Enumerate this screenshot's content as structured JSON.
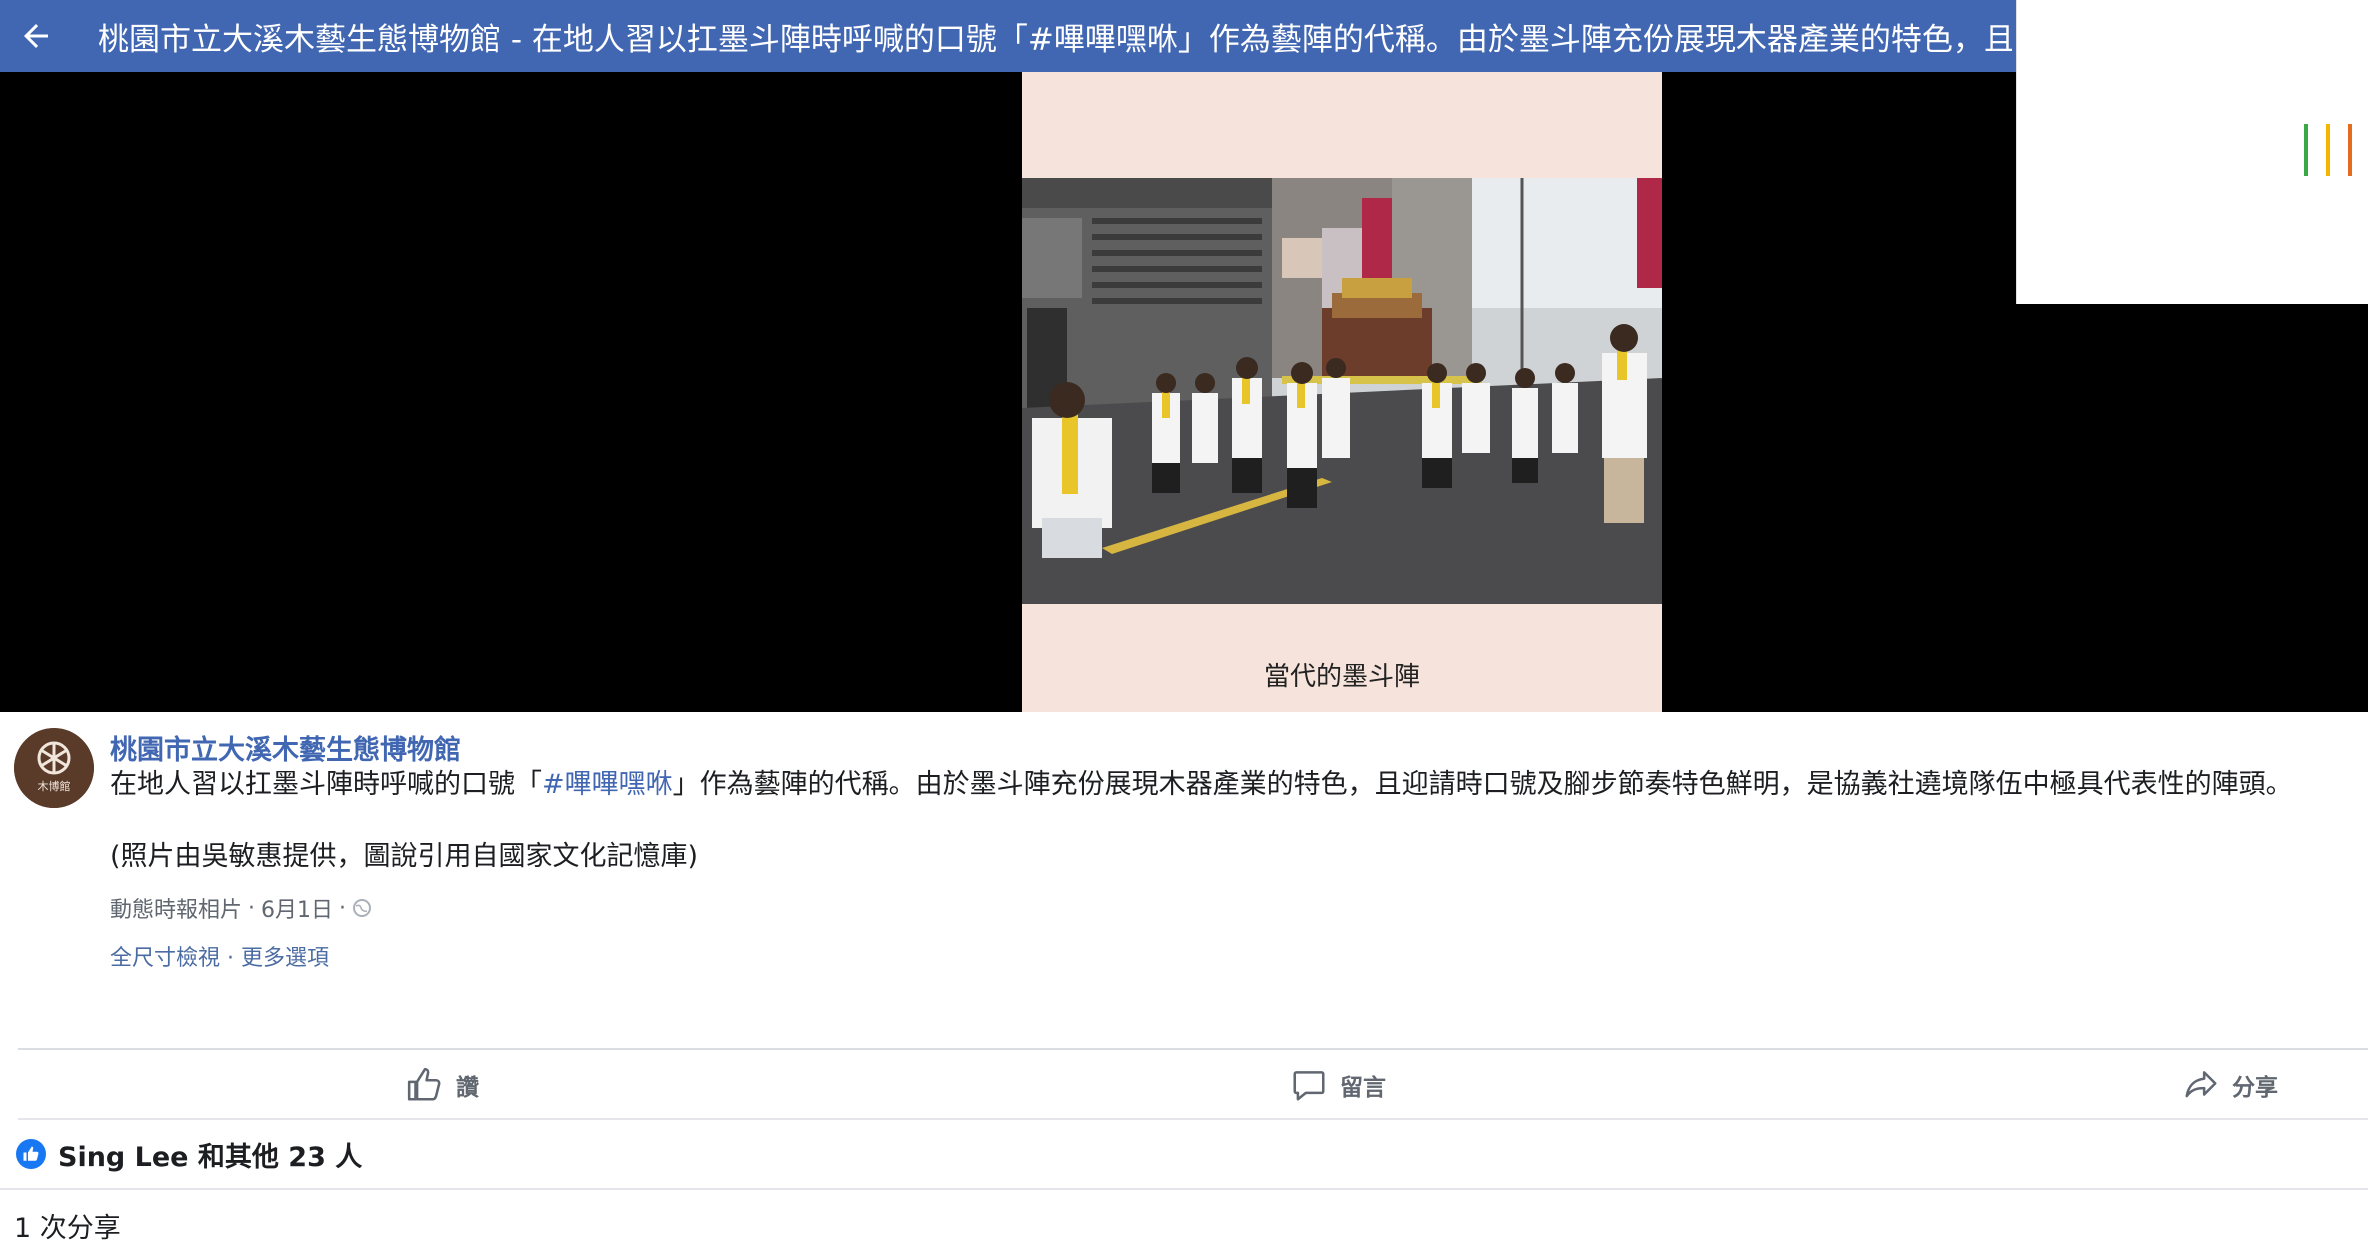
{
  "header": {
    "back_icon": "arrow-left-icon",
    "title": "桃園市立大溪木藝生態博物館 - 在地人習以扛墨斗陣時呼喊的口號「#嗶嗶嘿咻」作為藝陣的代稱。由於墨斗陣充份展現木器產業的特色，且迎請時口號及腳步節奏特色鮮明，是協義社遶境隊伍中極具代表性的陣頭。"
  },
  "photo": {
    "caption_art": "當代的墨斗陣",
    "background": "#f6e4dc"
  },
  "loader_colors": [
    "#3aa845",
    "#f2b600",
    "#e56b1f"
  ],
  "post": {
    "page_name": "桃園市立大溪木藝生態博物館",
    "avatar_text": "木博館",
    "desc_prefix": "在地人習以扛墨斗陣時呼喊的口號「",
    "hashtag": "#嗶嗶嘿咻",
    "desc_suffix": "」作為藝陣的代稱。由於墨斗陣充份展現木器產業的特色，且迎請時口號及腳步節奏特色鮮明，是協義社遶境隊伍中極具代表性的陣頭。",
    "credit": "(照片由吳敏惠提供，圖說引用自國家文化記憶庫)",
    "album": "動態時報相片",
    "date": "6月1日",
    "separator": "·",
    "privacy_icon": "globe-icon",
    "full_size": "全尺寸檢視",
    "more_options": "更多選項"
  },
  "actions": {
    "like": "讚",
    "comment": "留言",
    "share": "分享"
  },
  "reactions": {
    "likes_text": "Sing Lee 和其他 23 人",
    "shares_text": "1 次分享"
  },
  "colors": {
    "brand": "#4267b2",
    "like_blue": "#1877f2"
  }
}
